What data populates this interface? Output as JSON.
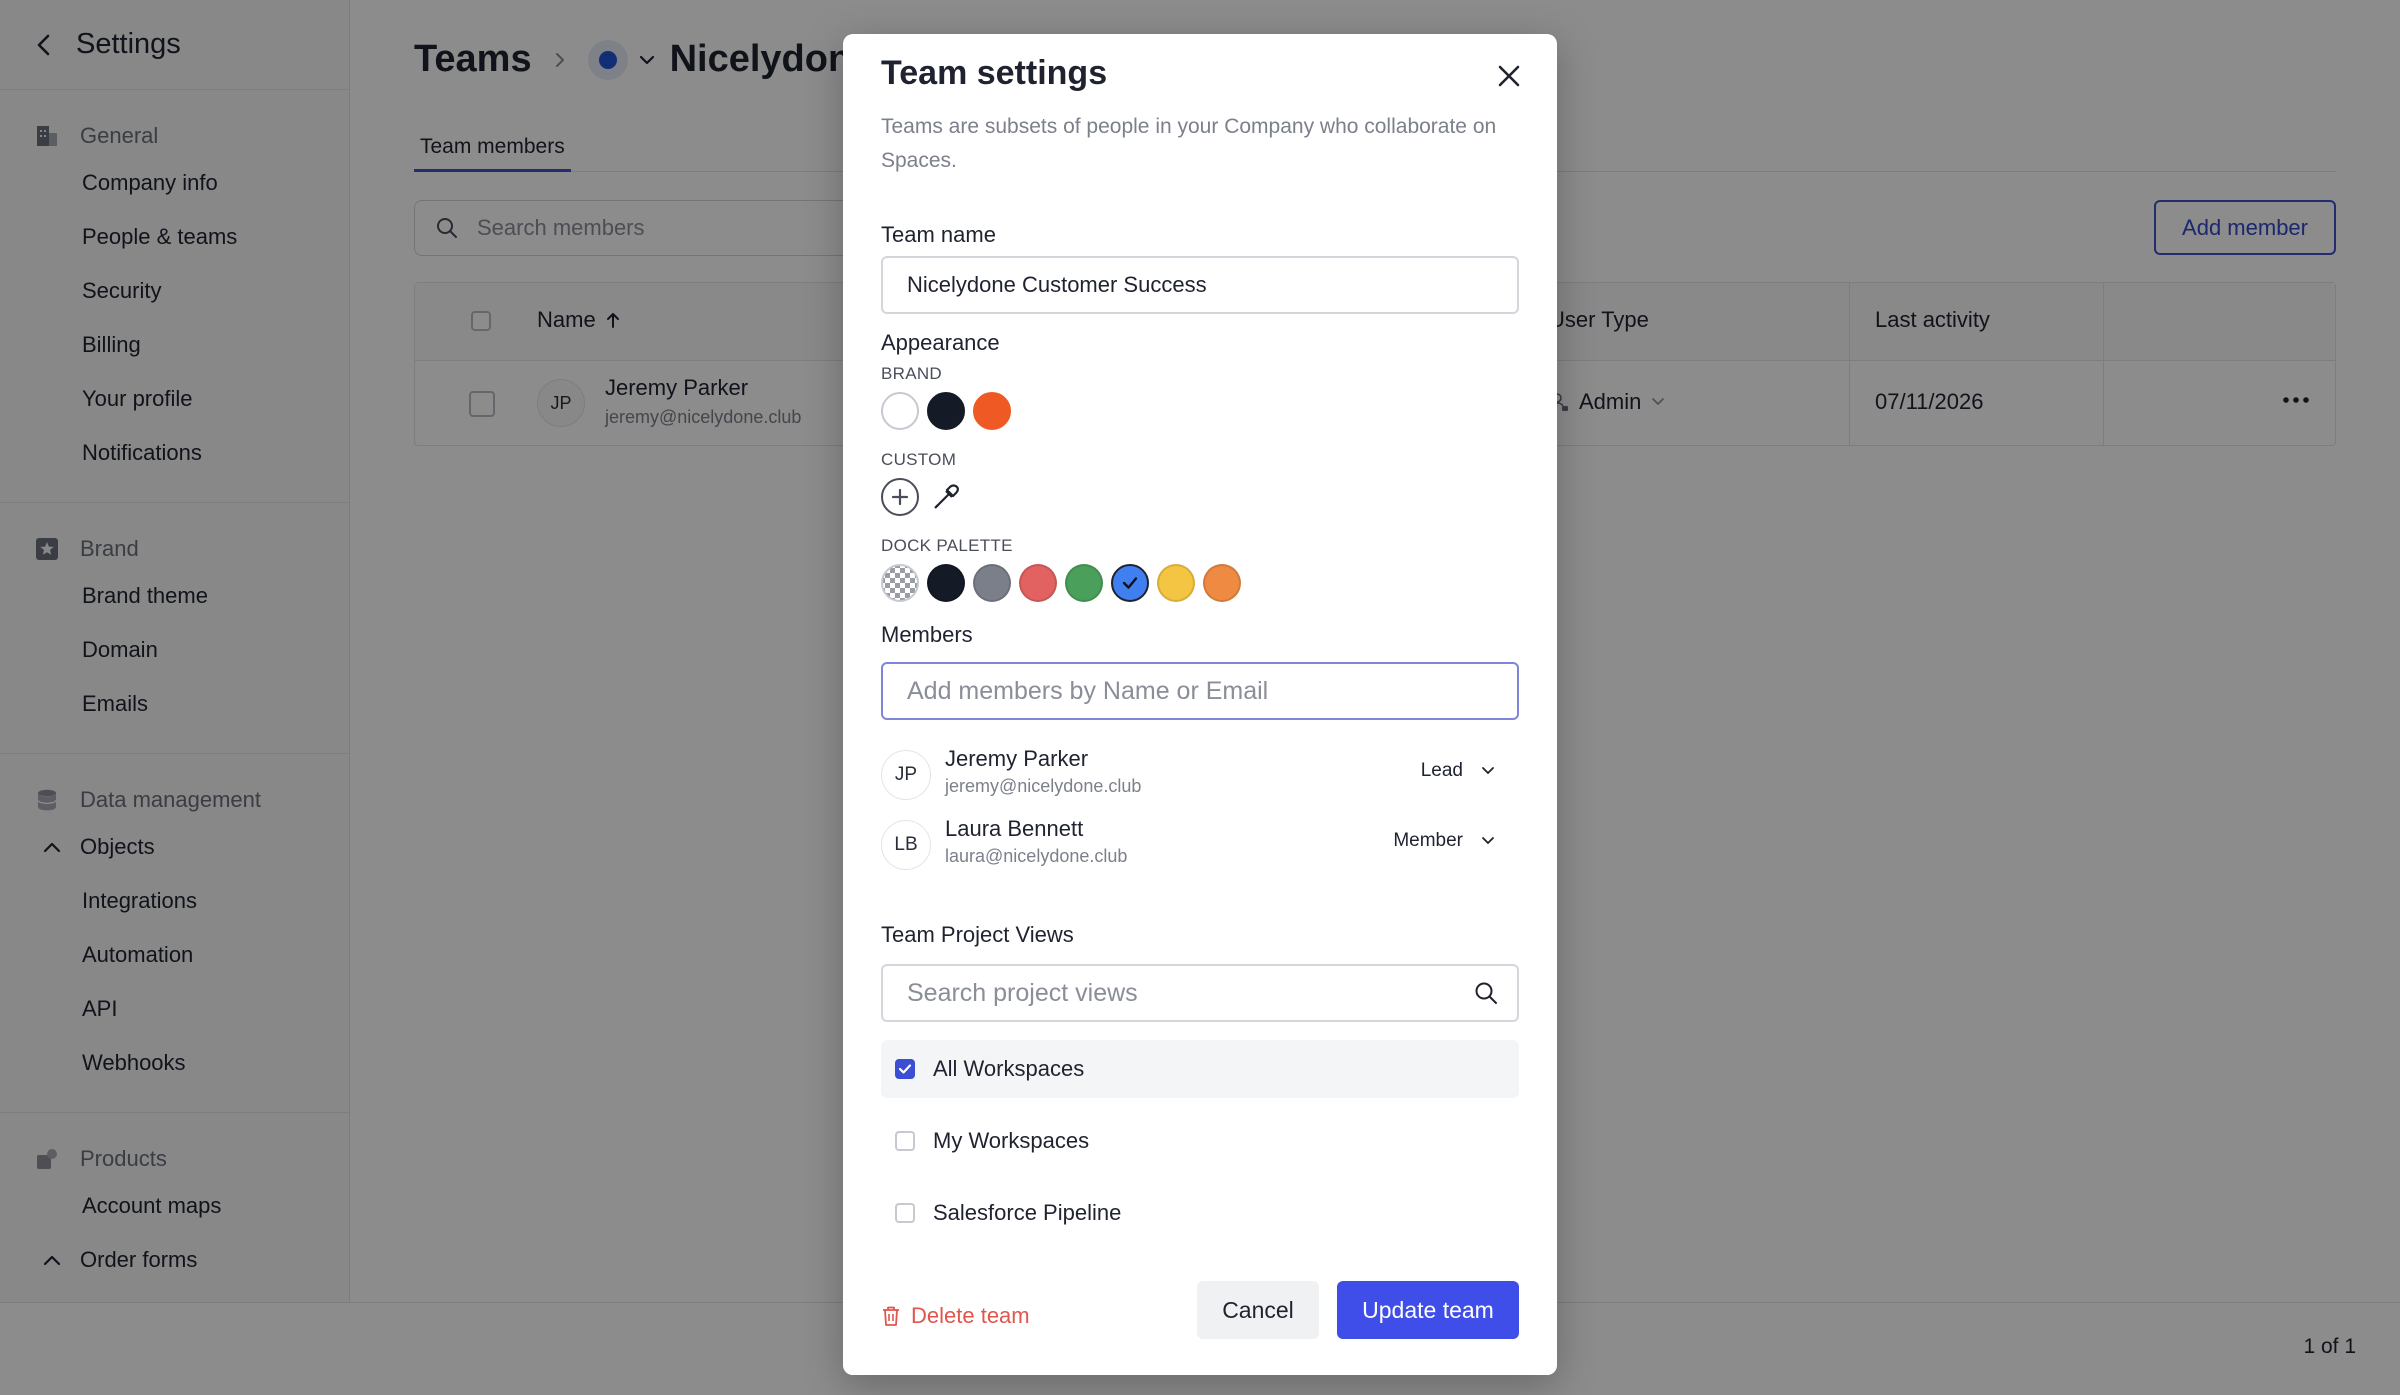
{
  "sidebar": {
    "title": "Settings",
    "sections": [
      {
        "group": "General",
        "icon": "building-icon",
        "items": [
          "Company info",
          "People & teams",
          "Security",
          "Billing",
          "Your profile",
          "Notifications"
        ]
      },
      {
        "group": "Brand",
        "icon": "star-icon",
        "items": [
          "Brand theme",
          "Domain",
          "Emails"
        ]
      },
      {
        "group": "Data management",
        "icon": "database-icon",
        "sub": "Objects",
        "items": [
          "Integrations",
          "Automation",
          "API",
          "Webhooks"
        ]
      },
      {
        "group": "Products",
        "icon": "cube-icon",
        "items": [
          "Account maps"
        ],
        "sub_after": "Order forms"
      }
    ]
  },
  "main": {
    "breadcrumb_root": "Teams",
    "breadcrumb_team": "Nicelydone",
    "tab": "Team members",
    "search_placeholder": "Search members",
    "add_member": "Add member",
    "columns": {
      "name": "Name",
      "user_type": "User Type",
      "last_activity": "Last activity"
    },
    "rows": [
      {
        "initials": "JP",
        "name": "Jeremy Parker",
        "email": "jeremy@nicelydone.club",
        "user_type": "Admin",
        "last_activity": "07/11/2026"
      }
    ],
    "pager": "1 of 1"
  },
  "modal": {
    "title": "Team settings",
    "description": "Teams are subsets of people in your Company who collaborate on Spaces.",
    "team_name_label": "Team name",
    "team_name_value": "Nicelydone Customer Success",
    "appearance_label": "Appearance",
    "brand_label": "BRAND",
    "brand_colors": [
      "#ffffff",
      "#151a27",
      "#ef5a24"
    ],
    "custom_label": "CUSTOM",
    "dock_label": "DOCK PALETTE",
    "dock_colors": [
      "checker",
      "#151a27",
      "#7b7f8a",
      "#e26262",
      "#4aa05a",
      "#3f7ff0",
      "#f4c443",
      "#ef8a42"
    ],
    "dock_selected_index": 5,
    "members_label": "Members",
    "members_placeholder": "Add members by Name or Email",
    "members": [
      {
        "initials": "JP",
        "name": "Jeremy Parker",
        "email": "jeremy@nicelydone.club",
        "role": "Lead"
      },
      {
        "initials": "LB",
        "name": "Laura Bennett",
        "email": "laura@nicelydone.club",
        "role": "Member"
      }
    ],
    "project_views_label": "Team Project Views",
    "project_views_placeholder": "Search project views",
    "project_views": [
      {
        "label": "All Workspaces",
        "checked": true
      },
      {
        "label": "My Workspaces",
        "checked": false
      },
      {
        "label": "Salesforce Pipeline",
        "checked": false
      }
    ],
    "delete_label": "Delete team",
    "cancel_label": "Cancel",
    "update_label": "Update team"
  }
}
